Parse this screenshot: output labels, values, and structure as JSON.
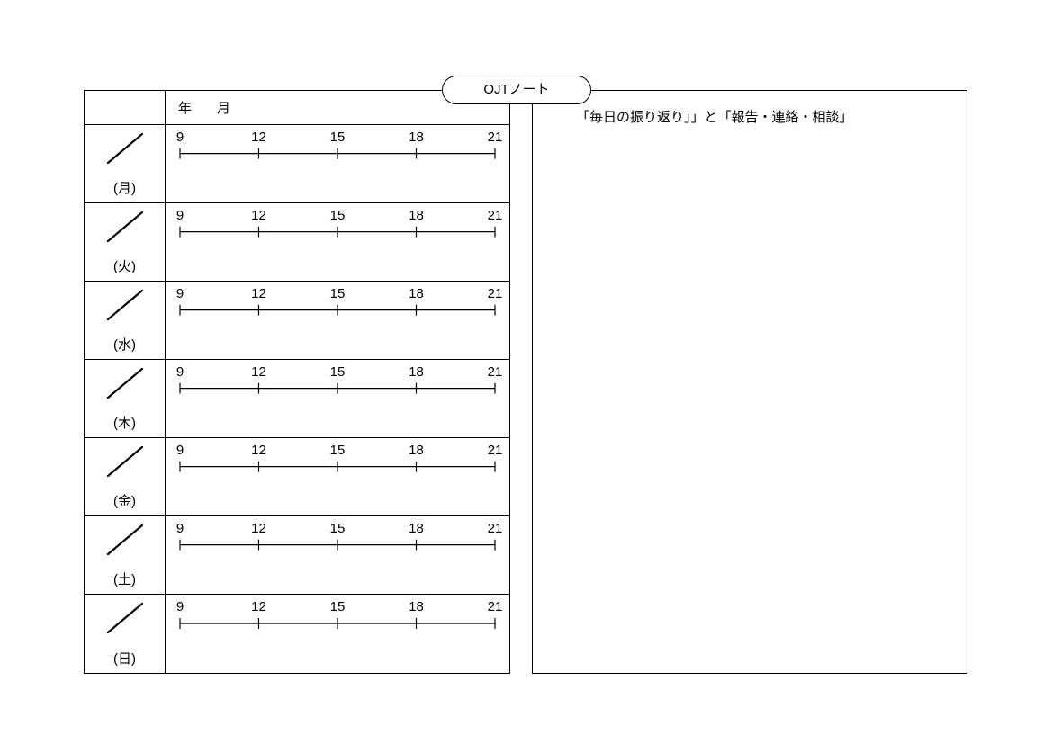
{
  "title": "OJTノート",
  "header": {
    "year_label": "年",
    "month_label": "月"
  },
  "days": [
    {
      "label": "(月)"
    },
    {
      "label": "(火)"
    },
    {
      "label": "(水)"
    },
    {
      "label": "(木)"
    },
    {
      "label": "(金)"
    },
    {
      "label": "(土)"
    },
    {
      "label": "(日)"
    }
  ],
  "time_ticks": [
    "9",
    "12",
    "15",
    "18",
    "21"
  ],
  "right_header": "「毎日の振り返り」」と「報告・連絡・相談」"
}
